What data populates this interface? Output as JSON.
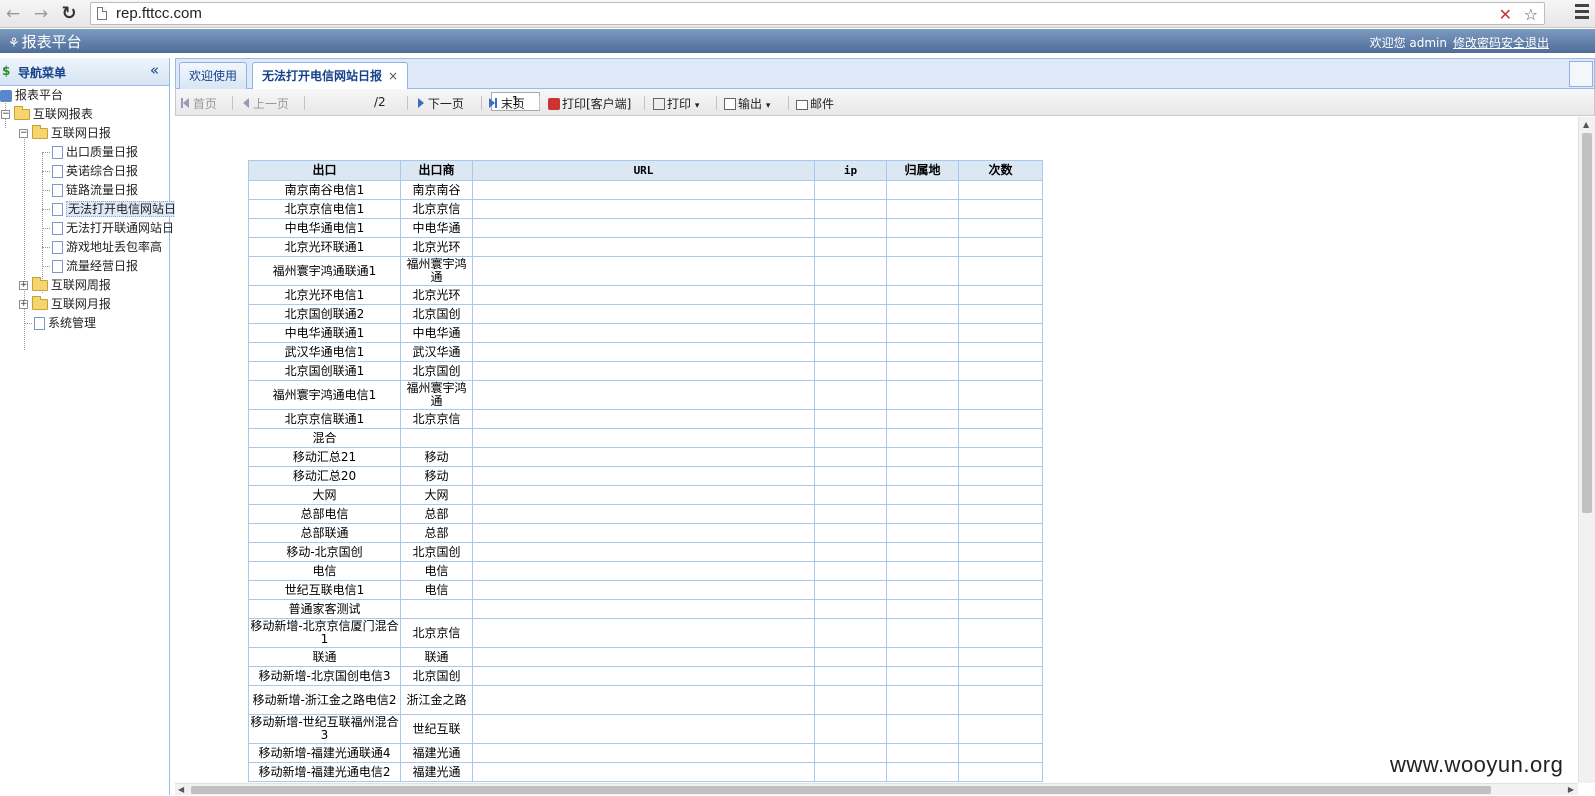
{
  "browser": {
    "url": "rep.fttcc.com"
  },
  "header": {
    "title": "报表平台",
    "welcome": "欢迎您 admin",
    "link": "修改密码安全退出"
  },
  "sidebar": {
    "title": "导航菜单",
    "collapse_glyph": "«",
    "tree": {
      "root": "报表平台",
      "internet_reports": "互联网报表",
      "daily": "互联网日报",
      "daily_items": [
        "出口质量日报",
        "英诺综合日报",
        "链路流量日报",
        "无法打开电信网站日",
        "无法打开联通网站日",
        "游戏地址丢包率高",
        "流量经营日报"
      ],
      "weekly": "互联网周报",
      "monthly": "互联网月报",
      "system": "系统管理"
    }
  },
  "tabs": [
    {
      "label": "欢迎使用"
    },
    {
      "label": "无法打开电信网站日报",
      "close": "×"
    }
  ],
  "toolbar": {
    "first": "首页",
    "prev": "上一页",
    "page": "1",
    "total": "/2",
    "next": "下一页",
    "last": "末页",
    "print_client": "打印[客户端]",
    "print": "打印",
    "export": "输出",
    "mail": "邮件"
  },
  "table": {
    "headers": [
      "出口",
      "出口商",
      "URL",
      "ip",
      "归属地",
      "次数"
    ],
    "rows": [
      [
        "南京南谷电信1",
        "南京南谷"
      ],
      [
        "北京京信电信1",
        "北京京信"
      ],
      [
        "中电华通电信1",
        "中电华通"
      ],
      [
        "北京光环联通1",
        "北京光环"
      ],
      [
        "福州寰宇鸿通联通1",
        "福州寰宇鸿通"
      ],
      [
        "北京光环电信1",
        "北京光环"
      ],
      [
        "北京国创联通2",
        "北京国创"
      ],
      [
        "中电华通联通1",
        "中电华通"
      ],
      [
        "武汉华通电信1",
        "武汉华通"
      ],
      [
        "北京国创联通1",
        "北京国创"
      ],
      [
        "福州寰宇鸿通电信1",
        "福州寰宇鸿通"
      ],
      [
        "北京京信联通1",
        "北京京信"
      ],
      [
        "混合",
        ""
      ],
      [
        "移动汇总21",
        "移动"
      ],
      [
        "移动汇总20",
        "移动"
      ],
      [
        "大网",
        "大网"
      ],
      [
        "总部电信",
        "总部"
      ],
      [
        "总部联通",
        "总部"
      ],
      [
        "移动-北京国创",
        "北京国创"
      ],
      [
        "电信",
        "电信"
      ],
      [
        "世纪互联电信1",
        "电信"
      ],
      [
        "普通家客测试",
        ""
      ],
      [
        "移动新增-北京京信厦门混合1",
        "北京京信"
      ],
      [
        "联通",
        "联通"
      ],
      [
        "移动新增-北京国创电信3",
        "北京国创"
      ],
      [
        "移动新增-浙江金之路电信2",
        "浙江金之路"
      ],
      [
        "移动新增-世纪互联福州混合3",
        "世纪互联"
      ],
      [
        "移动新增-福建光通联通4",
        "福建光通"
      ],
      [
        "移动新增-福建光通电信2",
        "福建光通"
      ]
    ]
  },
  "watermark": "www.wooyun.org"
}
